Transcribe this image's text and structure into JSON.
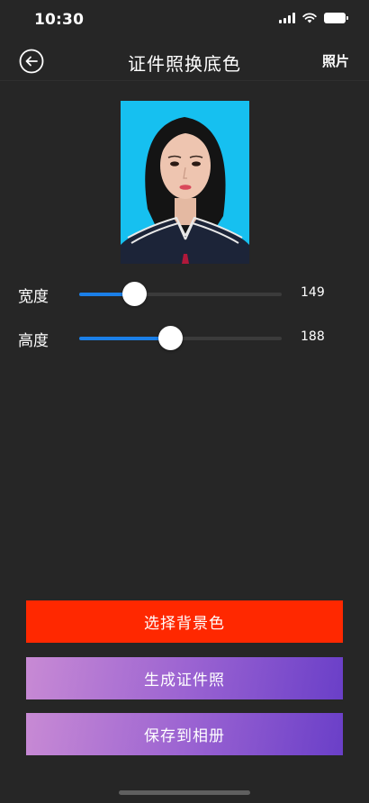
{
  "status_bar": {
    "time": "10:30"
  },
  "nav": {
    "title": "证件照换底色",
    "right_action": "照片",
    "back_icon": "back-arrow-icon"
  },
  "portrait": {
    "background_color": "#16c0f0"
  },
  "sliders": [
    {
      "label": "宽度",
      "value": "149",
      "fill": 0.27
    },
    {
      "label": "高度",
      "value": "188",
      "fill": 0.45
    }
  ],
  "buttons": {
    "select_bg": "选择背景色",
    "generate": "生成证件照",
    "save": "保存到相册"
  },
  "colors": {
    "background": "#262626",
    "accent_red": "#ff2800",
    "slider_blue": "#1b7fe8",
    "gradient_start": "#c88ad4",
    "gradient_end": "#6a3fc8"
  }
}
